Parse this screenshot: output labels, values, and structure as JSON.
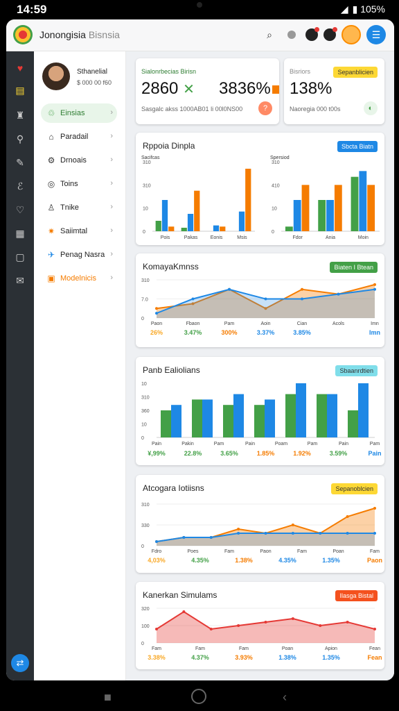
{
  "status": {
    "time": "14:59",
    "battery": "▮ 105%"
  },
  "header": {
    "title": "Jonongisia",
    "title_light": "Bisnsia",
    "search_icon": "⌕",
    "menu_icon": "☰"
  },
  "profile": {
    "name": "Sthanelial",
    "sub": "$ 000 00 f60"
  },
  "nav": [
    {
      "label": "Einsias",
      "icon": "♲",
      "active": true
    },
    {
      "label": "Paradail",
      "icon": "⌂"
    },
    {
      "label": "Drnoais",
      "icon": "⚙"
    },
    {
      "label": "Toins",
      "icon": "◎"
    },
    {
      "label": "Tnike",
      "icon": "♙"
    },
    {
      "label": "Saiimtal",
      "icon": "✷"
    },
    {
      "label": "Penag Nasra",
      "icon": "✈"
    },
    {
      "label": "Modelnicis",
      "icon": "▣"
    }
  ],
  "fab_icon": "⇄",
  "kpis": [
    {
      "label": "Sialonrbecias Birisn",
      "value1": "2860",
      "value2": "3836%",
      "footer": "Sasgalc akss 1000AB01 li 00l0NS00"
    },
    {
      "label": "Bisriors",
      "badge": "Sepanblicien",
      "value1": "138%",
      "footer": "Naoregia 000 t00s"
    }
  ],
  "cards": [
    {
      "title": "Rppoia Dinpla",
      "badge": "Sbcta Biatn"
    },
    {
      "title": "KomayaKmnss",
      "badge": "Biaten I Btean"
    },
    {
      "title": "Panb Ealiolians",
      "badge": "Sbaanrdtien"
    },
    {
      "title": "Atcogara Iotiisns",
      "badge": "Sepanoblcien"
    },
    {
      "title": "Kanerkan Simulams",
      "badge": "Ilasga Bistal"
    }
  ],
  "colors": {
    "green": "#43a047",
    "blue": "#1e88e5",
    "orange": "#f57c00",
    "yellow": "#fdd835",
    "red": "#e53935",
    "teal": "#26c6da"
  },
  "chart_data": [
    {
      "type": "bar",
      "title": "Rppoia Dinpla",
      "subcharts": [
        {
          "ylabel": "Sacifcas",
          "yticks": [
            "0",
            "10",
            "310",
            "310"
          ],
          "categories": [
            "Pois",
            "Pakas",
            "Eonis",
            "Msis"
          ],
          "series": [
            {
              "values": [
                9,
                3,
                0,
                0
              ],
              "color": "#43a047"
            },
            {
              "values": [
                27,
                15,
                5,
                17
              ],
              "color": "#1e88e5"
            },
            {
              "values": [
                4,
                35,
                4,
                54
              ],
              "color": "#f57c00"
            }
          ]
        },
        {
          "ylabel": "Spersiod",
          "yticks": [
            "0",
            "10",
            "410",
            "310"
          ],
          "categories": [
            "Fdor",
            "Ania",
            "Moin"
          ],
          "series": [
            {
              "values": [
                4,
                27,
                47
              ],
              "color": "#43a047"
            },
            {
              "values": [
                27,
                27,
                52
              ],
              "color": "#1e88e5"
            },
            {
              "values": [
                40,
                40,
                40
              ],
              "color": "#f57c00"
            }
          ]
        }
      ]
    },
    {
      "type": "area",
      "title": "KomayaKmnss",
      "yticks": [
        "0",
        "7.0",
        "310"
      ],
      "categories": [
        "Paon",
        "Fbaon",
        "Pam",
        "Aoin",
        "Cian",
        "Acols",
        "Imn"
      ],
      "values_labels": [
        "26%",
        "3.47%",
        "300%",
        "3.37%",
        "3.85%",
        "",
        "Imn"
      ],
      "series": [
        {
          "name": "",
          "values": [
            2,
            3,
            6,
            2,
            6,
            5,
            7
          ],
          "color": "#f57c00"
        },
        {
          "name": "",
          "values": [
            1,
            4,
            6,
            4,
            4,
            5,
            6
          ],
          "color": "#1e88e5"
        }
      ]
    },
    {
      "type": "bar",
      "title": "Panb Ealiolians",
      "yticks": [
        "0",
        "10",
        "360",
        "310",
        "10"
      ],
      "categories": [
        "Pain",
        "Pakin",
        "Pam",
        "Pain",
        "Poam",
        "Pam",
        "Pain",
        "Pam"
      ],
      "values_labels": [
        "¥,99%",
        "22.8%",
        "3.65%",
        "1.85%",
        "1.92%",
        "3.59%",
        "Pain"
      ],
      "series": [
        {
          "values": [
            5,
            7,
            6,
            6,
            8,
            8,
            5
          ],
          "color": "#43a047"
        },
        {
          "values": [
            6,
            7,
            8,
            7,
            10,
            8,
            10
          ],
          "color": "#1e88e5"
        }
      ]
    },
    {
      "type": "area",
      "title": "Atcogara Iotiisns",
      "yticks": [
        "0",
        "330",
        "310"
      ],
      "categories": [
        "Fdro",
        "Poes",
        "Fam",
        "Paon",
        "Fam",
        "Poan",
        "Fam"
      ],
      "values_labels": [
        "4,03%",
        "4.35%",
        "1.38%",
        "4.35%",
        "1.35%",
        "Paon"
      ],
      "series": [
        {
          "values": [
            1,
            2,
            2,
            4,
            3,
            5,
            3,
            7,
            9
          ],
          "color": "#f57c00"
        },
        {
          "values": [
            1,
            2,
            2,
            3,
            3,
            3,
            3,
            3,
            3
          ],
          "color": "#1e88e5"
        }
      ]
    },
    {
      "type": "area",
      "title": "Kanerkan Simulams",
      "yticks": [
        "0",
        "100",
        "320"
      ],
      "categories": [
        "Fam",
        "Fam",
        "Fam",
        "Poan",
        "Apion",
        "Fean"
      ],
      "values_labels": [
        "3.38%",
        "4.37%",
        "3.93%",
        "1.38%",
        "1.35%",
        "Fean"
      ],
      "series": [
        {
          "values": [
            4,
            9,
            4,
            5,
            6,
            7,
            5,
            6,
            4
          ],
          "color": "#e53935"
        }
      ]
    }
  ]
}
